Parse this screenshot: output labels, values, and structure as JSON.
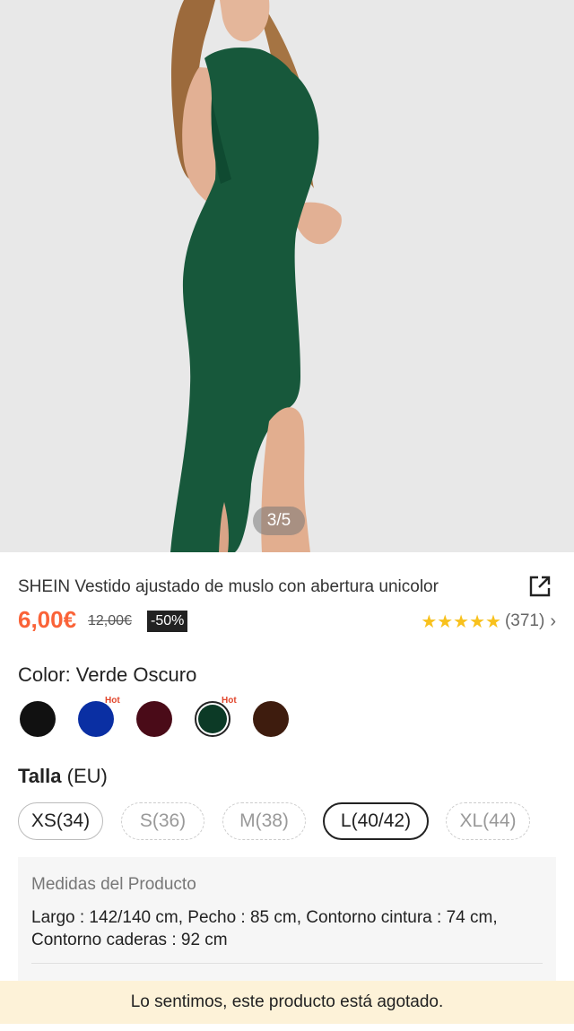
{
  "gallery": {
    "pager": "3/5",
    "image": "model-wearing-green-dress"
  },
  "product": {
    "title": "SHEIN Vestido ajustado de muslo con abertura unicolor",
    "price": "6,00€",
    "old_price": "12,00€",
    "discount": "-50%",
    "rating_stars": "★★★★★",
    "rating_count": "(371)",
    "rating_chevron": "›"
  },
  "color": {
    "label": "Color: Verde Oscuro",
    "swatches": [
      {
        "color": "#111111",
        "hot": ""
      },
      {
        "color": "#0a2fa3",
        "hot": "Hot"
      },
      {
        "color": "#4a0b18",
        "hot": ""
      },
      {
        "color": "#0c3a26",
        "hot": "Hot",
        "selected": true
      },
      {
        "color": "#3e1c0e",
        "hot": ""
      }
    ]
  },
  "size": {
    "label_bold": "Talla",
    "label_unit": " (EU)",
    "options": [
      "XS(34)",
      "S(36)",
      "M(38)",
      "L(40/42)",
      "XL(44)"
    ]
  },
  "measures": {
    "title": "Medidas del Producto",
    "body": "Largo : 142/140 cm,  Pecho : 85 cm,  Contorno cintura : 74 cm,  Contorno caderas : 92 cm"
  },
  "notice": "Lo sentimos, este producto está agotado.",
  "colors": {
    "accent": "#fa6338",
    "star": "#f8c11d",
    "notice_bg": "#fdf2d8",
    "dress": "#17583b"
  }
}
